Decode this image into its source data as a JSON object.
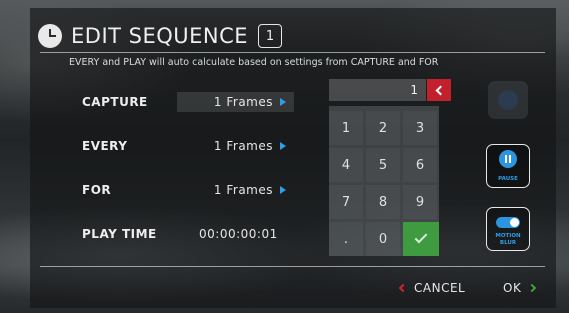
{
  "header": {
    "title": "EDIT SEQUENCE",
    "sequence_number": "1",
    "icon": "clock-icon"
  },
  "note": "EVERY and PLAY will auto calculate based on settings from CAPTURE and FOR",
  "rows": [
    {
      "label": "CAPTURE",
      "value": "1 Frames",
      "active": true
    },
    {
      "label": "EVERY",
      "value": "1 Frames",
      "active": false
    },
    {
      "label": "FOR",
      "value": "1 Frames",
      "active": false
    },
    {
      "label": "PLAY TIME",
      "value": "00:00:00:01"
    }
  ],
  "keypad": {
    "display": "1",
    "keys": [
      "1",
      "2",
      "3",
      "4",
      "5",
      "6",
      "7",
      "8",
      "9",
      ".",
      "0"
    ],
    "confirm_icon": "check-icon",
    "backspace_icon": "backspace-icon"
  },
  "side_buttons": {
    "pause": {
      "label": "PAUSE",
      "icon": "pause-icon"
    },
    "motion_blur": {
      "line1": "MOTION",
      "line2": "BLUR",
      "icon": "toggle-icon",
      "enabled": true
    }
  },
  "footer": {
    "cancel": "CANCEL",
    "ok": "OK"
  },
  "colors": {
    "accent_blue": "#2e9ee8",
    "cancel_red": "#d3252f",
    "confirm_green": "#3f9b3f"
  }
}
